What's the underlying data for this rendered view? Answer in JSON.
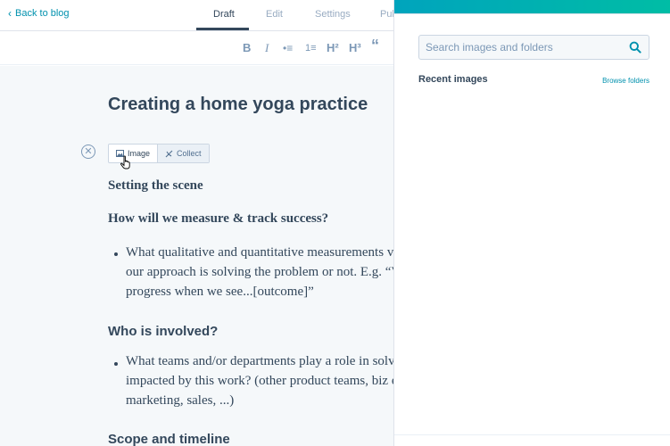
{
  "topbar": {
    "back_label": "Back to blog",
    "tabs": [
      "Draft",
      "Edit",
      "Settings",
      "Pub"
    ]
  },
  "toolbar": {
    "bold": "B",
    "italic": "I",
    "bullets": "•≡",
    "numbered": "1≡",
    "h2": "H²",
    "h3": "H³",
    "quote": "“"
  },
  "editor": {
    "title": "Creating a home yoga practice",
    "insert": {
      "image_label": "Image",
      "collect_label": "Collect"
    },
    "sections": [
      {
        "heading": "Setting the scene"
      },
      {
        "heading": "How will we measure & track success?",
        "lines": [
          "What qualitative and quantitative measurements v",
          "our approach is solving the problem or not. E.g. “V",
          "progress when we see...[outcome]”"
        ]
      },
      {
        "heading": "Who is involved?",
        "lines": [
          "What teams and/or departments play a role in solv",
          "impacted by this work? (other product teams, biz e",
          "marketing, sales, ...)"
        ]
      },
      {
        "heading": "Scope and timeline"
      }
    ]
  },
  "panel": {
    "search_placeholder": "Search images and folders",
    "recent_label": "Recent images",
    "browse_label": "Browse folders"
  },
  "colors": {
    "accent": "#0091ae",
    "text": "#33475b",
    "header_start": "#00a4bd",
    "header_end": "#00bda5"
  }
}
